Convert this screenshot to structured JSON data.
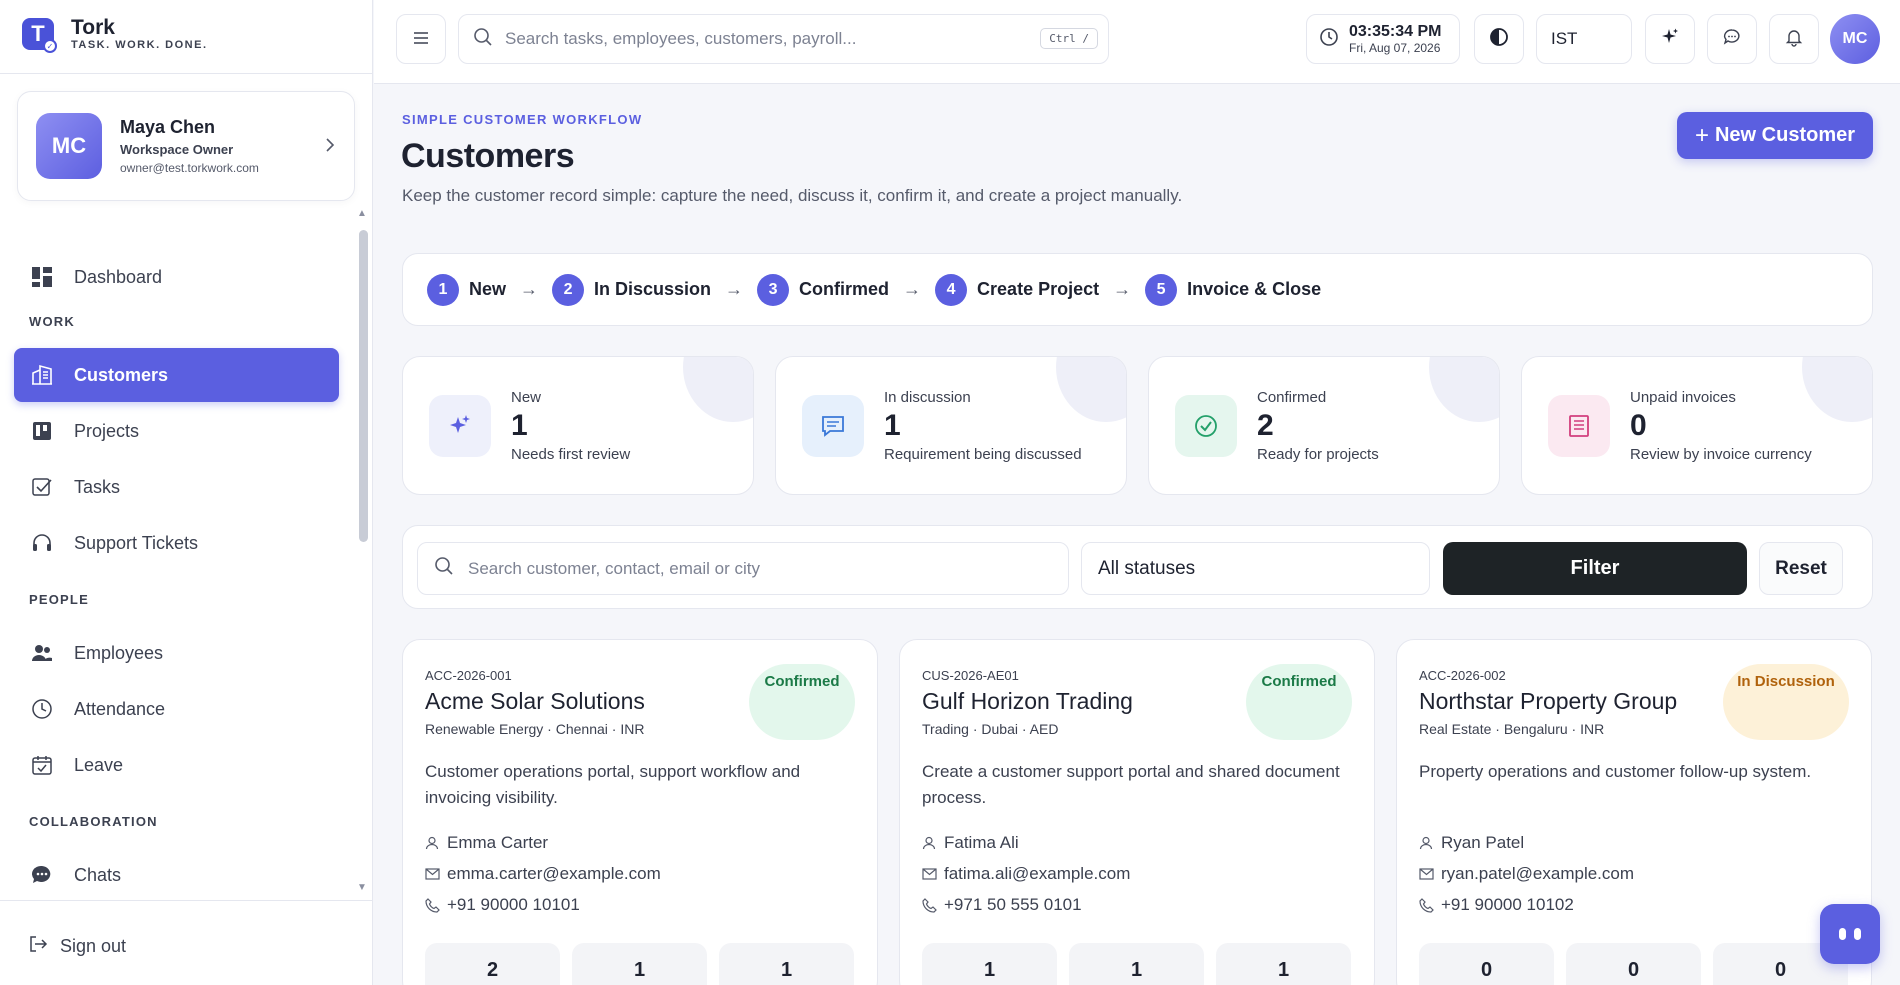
{
  "brand": {
    "name": "Tork",
    "tagline": "TASK. WORK. DONE.",
    "logo_letter": "T"
  },
  "profile": {
    "initials": "MC",
    "name": "Maya Chen",
    "role": "Workspace Owner",
    "email": "owner@test.torkwork.com"
  },
  "nav": {
    "dashboard": "Dashboard",
    "section_work": "WORK",
    "customers": "Customers",
    "projects": "Projects",
    "tasks": "Tasks",
    "support": "Support Tickets",
    "section_people": "PEOPLE",
    "employees": "Employees",
    "attendance": "Attendance",
    "leave": "Leave",
    "section_collab": "COLLABORATION",
    "chats": "Chats",
    "sign_out": "Sign out"
  },
  "topbar": {
    "search_placeholder": "Search tasks, employees, customers, payroll...",
    "shortcut": "Ctrl /",
    "time": "03:35:34 PM",
    "date": "Fri, Aug 07, 2026",
    "timezone": "IST",
    "avatar_initials": "MC"
  },
  "page": {
    "eyebrow": "SIMPLE CUSTOMER WORKFLOW",
    "title": "Customers",
    "description": "Keep the customer record simple: capture the need, discuss it, confirm it, and create a project manually.",
    "new_button": "New Customer",
    "plus": "+"
  },
  "workflow": [
    {
      "num": "1",
      "label": "New"
    },
    {
      "num": "2",
      "label": "In Discussion"
    },
    {
      "num": "3",
      "label": "Confirmed"
    },
    {
      "num": "4",
      "label": "Create Project"
    },
    {
      "num": "5",
      "label": "Invoice & Close"
    }
  ],
  "arrow": "→",
  "stats": [
    {
      "label": "New",
      "value": "1",
      "sub": "Needs first review"
    },
    {
      "label": "In discussion",
      "value": "1",
      "sub": "Requirement being discussed"
    },
    {
      "label": "Confirmed",
      "value": "2",
      "sub": "Ready for projects"
    },
    {
      "label": "Unpaid invoices",
      "value": "0",
      "sub": "Review by invoice currency"
    }
  ],
  "filters": {
    "search_placeholder": "Search customer, contact, email or city",
    "status": "All statuses",
    "filter_label": "Filter",
    "reset_label": "Reset"
  },
  "customers": [
    {
      "code": "ACC-2026-001",
      "name": "Acme Solar Solutions",
      "meta": "Renewable Energy · Chennai · INR",
      "status": "Confirmed",
      "description": "Customer operations portal, support workflow and invoicing visibility.",
      "contact": "Emma Carter",
      "email": "emma.carter@example.com",
      "phone": "+91 90000 10101",
      "metrics": [
        "2",
        "1",
        "1"
      ]
    },
    {
      "code": "CUS-2026-AE01",
      "name": "Gulf Horizon Trading",
      "meta": "Trading · Dubai · AED",
      "status": "Confirmed",
      "description": "Create a customer support portal and shared document process.",
      "contact": "Fatima Ali",
      "email": "fatima.ali@example.com",
      "phone": "+971 50 555 0101",
      "metrics": [
        "1",
        "1",
        "1"
      ]
    },
    {
      "code": "ACC-2026-002",
      "name": "Northstar Property Group",
      "meta": "Real Estate · Bengaluru · INR",
      "status": "In Discussion",
      "description": "Property operations and customer follow-up system.",
      "contact": "Ryan Patel",
      "email": "ryan.patel@example.com",
      "phone": "+91 90000 10102",
      "metrics": [
        "0",
        "0",
        "0"
      ]
    }
  ],
  "colors": {
    "accent": "#5b5fe0",
    "dark_button": "#1e2326",
    "confirmed_bg": "#e3f7ec",
    "confirmed_text": "#1b7a47",
    "discussion_bg": "#fdf1d8",
    "discussion_text": "#b0620c"
  }
}
